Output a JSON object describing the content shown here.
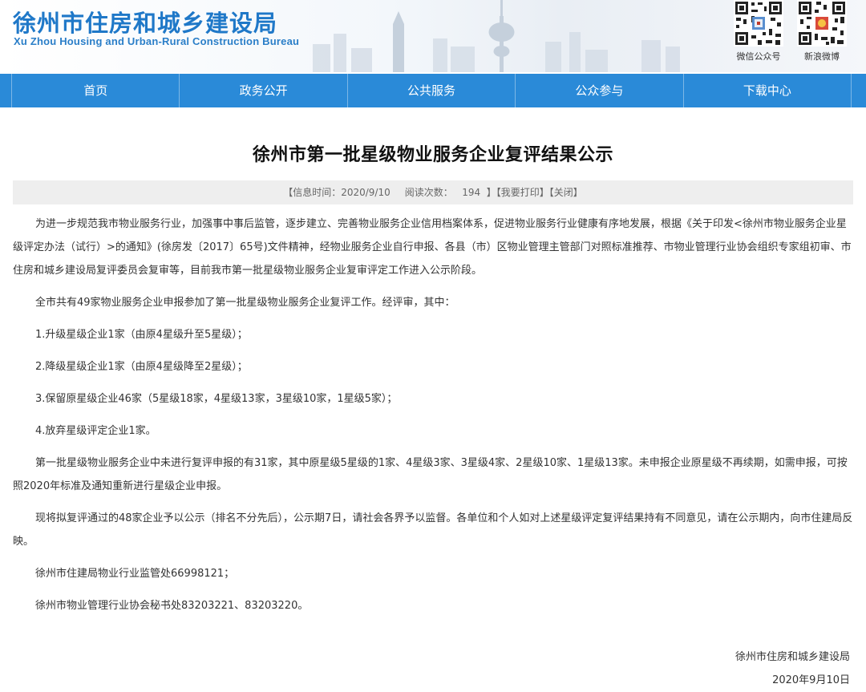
{
  "header": {
    "title": "徐州市住房和城乡建设局",
    "subtitle": "Xu Zhou Housing and Urban-Rural Construction Bureau",
    "qr_codes": [
      {
        "label": "微信公众号"
      },
      {
        "label": "新浪微博"
      }
    ]
  },
  "nav": {
    "items": [
      "首页",
      "政务公开",
      "公共服务",
      "公众参与",
      "下载中心"
    ]
  },
  "article": {
    "title": "徐州市第一批星级物业服务企业复评结果公示",
    "meta": {
      "time_label": "【信息时间：",
      "time_value": "2020/9/10",
      "views_label": "阅读次数：",
      "views_value": "194",
      "views_close": "】",
      "print": "【我要打印】",
      "close": "【关闭】"
    },
    "paragraphs": [
      "为进一步规范我市物业服务行业，加强事中事后监管，逐步建立、完善物业服务企业信用档案体系，促进物业服务行业健康有序地发展，根据《关于印发<徐州市物业服务企业星级评定办法（试行）>的通知》(徐房发〔2017〕65号)文件精神，经物业服务企业自行申报、各县（市）区物业管理主管部门对照标准推荐、市物业管理行业协会组织专家组初审、市住房和城乡建设局复评委员会复审等，目前我市第一批星级物业服务企业复审评定工作进入公示阶段。",
      "全市共有49家物业服务企业申报参加了第一批星级物业服务企业复评工作。经评审，其中：",
      "1.升级星级企业1家（由原4星级升至5星级）；",
      "2.降级星级企业1家（由原4星级降至2星级）；",
      "3.保留原星级企业46家（5星级18家，4星级13家，3星级10家，1星级5家）；",
      "4.放弃星级评定企业1家。",
      "第一批星级物业服务企业中未进行复评申报的有31家，其中原星级5星级的1家、4星级3家、3星级4家、2星级10家、1星级13家。未申报企业原星级不再续期，如需申报，可按照2020年标准及通知重新进行星级企业申报。",
      "现将拟复评通过的48家企业予以公示（排名不分先后），公示期7日，请社会各界予以监督。各单位和个人如对上述星级评定复评结果持有不同意见，请在公示期内，向市住建局反映。",
      "徐州市住建局物业行业监管处66998121；",
      "徐州市物业管理行业协会秘书处83203221、83203220。"
    ],
    "signature": {
      "org": "徐州市住房和城乡建设局",
      "date": "2020年9月10日"
    }
  },
  "colors": {
    "nav_bg": "#2a8ad8",
    "title_blue": "#1f78c8",
    "meta_bg": "#eeeeee"
  }
}
